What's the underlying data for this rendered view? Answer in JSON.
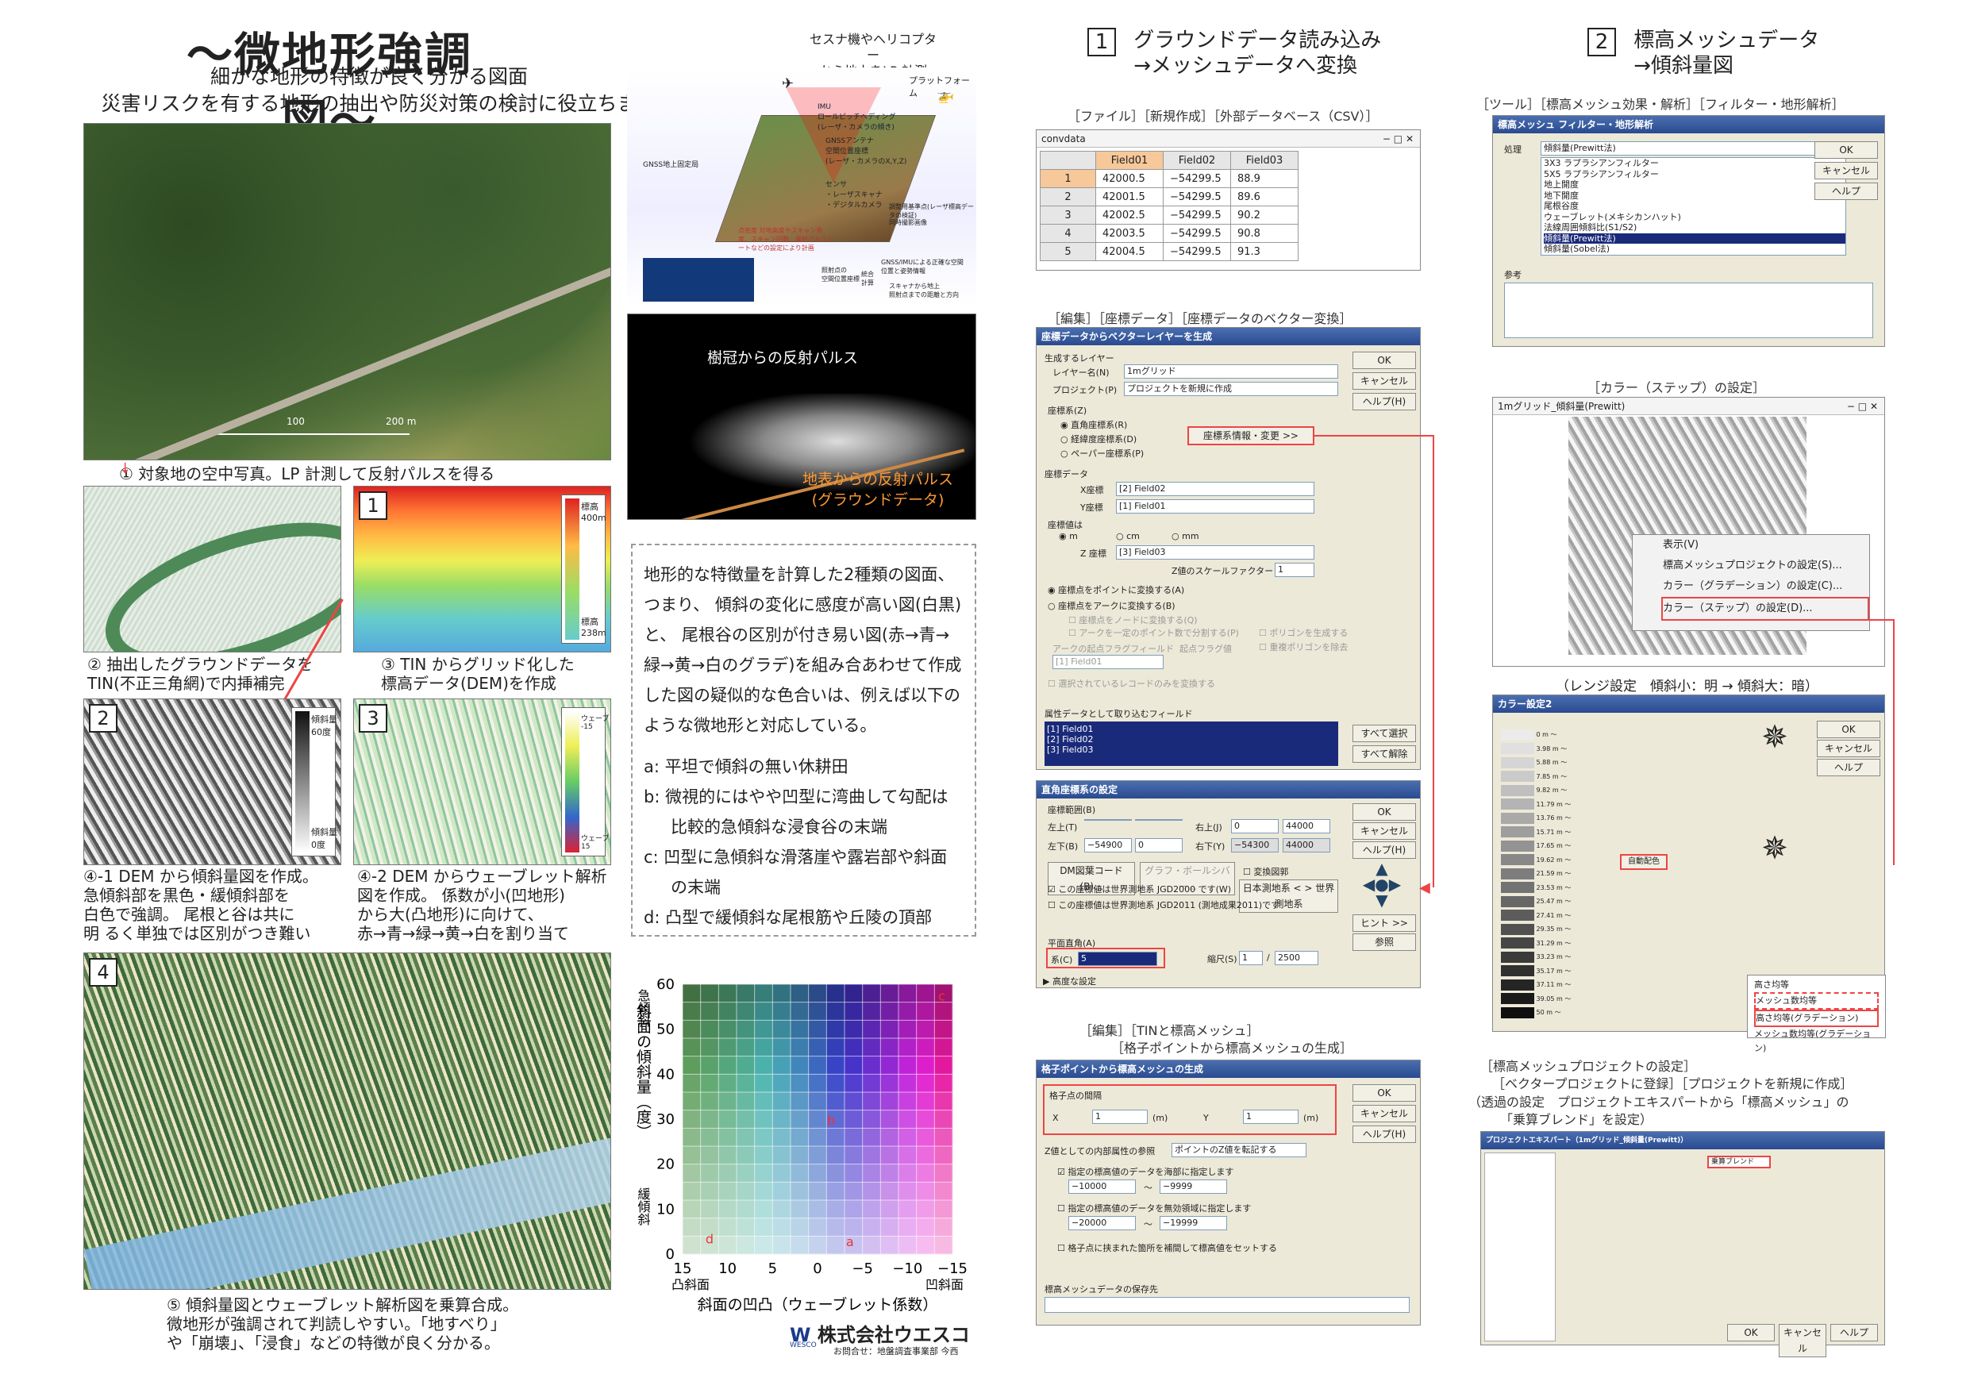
{
  "header": {
    "title": "〜微地形強調図〜",
    "subtitle1": "細かな地形の特徴が良く分かる図面",
    "subtitle2": "災害リスクを有する地形の抽出や防災対策の検討に役立ちます"
  },
  "captions": {
    "c1": "①  対象地の空中写真。LP 計測して反射パルスを得る",
    "c2a": "②  抽出したグラウンドデータを",
    "c2b": "TIN(不正三角網)で内挿補完",
    "c3a": "③  TIN からグリッド化した",
    "c3b": "標高データ(DEM)を作成",
    "c41a": "④-1 DEM から傾斜量図を作成。",
    "c41b": "急傾斜部を黒色・緩傾斜部を",
    "c41c": "白色で強調。 尾根と谷は共に",
    "c41d": "明 るく単独では区別がつき難い",
    "c42a": "④-2 DEM からウェーブレット解析",
    "c42b": "図を作成。 係数が小(凹地形)",
    "c42c": "から大(凸地形)に向けて、",
    "c42d": "赤→青→緑→黄→白を割り当て",
    "c5a": "⑤  傾斜量図とウェーブレット解析図を乗算合成。",
    "c5b": "微地形が強調されて判読しやすい。「地すべり」",
    "c5c": "や「崩壊」、「浸食」などの特徴が良く分かる。"
  },
  "panels": {
    "n1": "1",
    "n2": "2",
    "n3": "3",
    "n4": "4",
    "scale1": "100",
    "scale2": "200 m",
    "dem_top": "標高\n400m",
    "dem_bot": "標高\n238m",
    "slope_top": "傾斜量\n60度",
    "slope_bot": "傾斜量\n0度",
    "wav_top": "ウェーブレット係数\n-15",
    "wav_bot": "ウェーブレット係数\n15"
  },
  "lp": {
    "head1": "セスナ機やヘリコプター",
    "head2": "から地上をLP 計測",
    "platform": "プラットフォーム",
    "imu": "IMU\nロールピッチヘディング\n(レーザ・カメラの傾き)",
    "gnss_ant": "GNSSアンテナ\n空間位置座標\n(レーザ・カメラのX,Y,Z)",
    "sensor": "センサ\n・レーザスキャナ\n・デジタルカメラ",
    "ground_station": "GNSS地上固定局",
    "legend1": "調整用基準点(レーザ標高データの検証)",
    "legend2": "同時撮影画像",
    "irradiation": "照射点の\n空間位置座標",
    "integrated": "統合\n計算",
    "gnss_imu": "GNSS/IMUによる正確な空間位置と姿勢情報",
    "scanner": "スキャナから地上\n照射点までの距離と方向",
    "rr": "点密度\n対地高度やスキャン角度、スキャン回数、発射パルスレートなどの設定により計画"
  },
  "pulse": {
    "canopy": "樹冠からの反射パルス",
    "ground1": "地表からの反射パルス",
    "ground2": "(グラウンドデータ)"
  },
  "explain": {
    "p": "地形的な特徴量を計算した2種類の図面、つまり、 傾斜の変化に感度が高い図(白黒)と、 尾根谷の区別が付き易い図(赤→青→緑→黄→白のグラデ)を組み合あわせて作成した図の疑似的な色合いは、例えば以下のような微地形と対応している。",
    "a": "a: 平坦で傾斜の無い休耕田",
    "b": "b: 微視的にはやや凹型に湾曲して勾配は比較的急傾斜な浸食谷の末端",
    "c": "c: 凹型に急傾斜な滑落崖や露岩部や斜面の末端",
    "d": "d: 凸型で緩傾斜な尾根筋や丘陵の頂部"
  },
  "chart_data": {
    "type": "heatmap",
    "ylabel": "斜面の傾斜量（度）",
    "xlabel": "斜面の凹凸（ウェーブレット係数）",
    "y_top": "急傾斜",
    "y_bottom": "緩傾斜",
    "x_left": "凸斜面",
    "x_right": "凹斜面",
    "yticks": [
      60,
      50,
      40,
      30,
      20,
      10,
      0
    ],
    "xticks": [
      "15",
      "10",
      "5",
      "0",
      "−5",
      "−10",
      "−15"
    ],
    "ylim": [
      0,
      60
    ],
    "xlim": [
      15,
      -15
    ],
    "annotations": [
      "a",
      "b",
      "c",
      "d"
    ]
  },
  "company": {
    "name": "株式会社ウエスコ",
    "contact": "お問合せ：地盤調査事業部 今西",
    "mark": "WESCO"
  },
  "step1": {
    "num": "1",
    "line1": "グラウンドデータ読み込み",
    "line2": "→メッシュデータへ変換",
    "menu": "［ファイル］［新規作成］［外部データベース（CSV）］",
    "win_title": "convdata",
    "cols": [
      "Field01",
      "Field02",
      "Field03"
    ],
    "rows": [
      [
        "1",
        "42000.5",
        "−54299.5",
        "88.9"
      ],
      [
        "2",
        "42001.5",
        "−54299.5",
        "89.6"
      ],
      [
        "3",
        "42002.5",
        "−54299.5",
        "90.2"
      ],
      [
        "4",
        "42003.5",
        "−54299.5",
        "90.8"
      ],
      [
        "5",
        "42004.5",
        "−54299.5",
        "91.3"
      ]
    ]
  },
  "vec": {
    "menu": "［編集］［座標データ］［座標データのベクター変換］",
    "title": "座標データからベクターレイヤーを生成",
    "gen_layer": "生成するレイヤー",
    "layer_name": "レイヤー名(N)",
    "layer_val": "1mグリッド",
    "project": "プロジェクト(P)",
    "project_val": "プロジェクトを新規に作成",
    "coord": "座標系(Z)",
    "rect": "直角座標系(R)",
    "latlon": "経緯度座標系(D)",
    "paper": "ペーパー座標系(P)",
    "coordbtn": "座標系情報・変更 >>",
    "coord_data": "座標データ",
    "x": "X座標",
    "x_val": "[2] Field02",
    "y": "Y座標",
    "y_val": "[1] Field01",
    "unit": "座標値は",
    "m": "m",
    "cm": "cm",
    "mm": "mm",
    "z": "Z 座標",
    "z_val": "[3] Field03",
    "zscale": "Z値のスケールファクター",
    "zscale_val": "1",
    "as_point": "座標点をポイントに変換する(A)",
    "as_arc": "座標点をアークに変換する(B)",
    "as_node": "座標点をノードに変換する(Q)",
    "arc_split": "アークを一定のポイント数で分割する(P)",
    "poly": "ポリゴンを生成する",
    "poly2": "重複ポリゴンを除去",
    "arc_field": "アークの起点フラグフィールド",
    "start_flag": "起点フラグ値",
    "field_val": "[1] Field01",
    "selected": "選択されているレコードのみを変換する",
    "attr": "属性データとして取り込むフィールド",
    "fields": [
      "[1] Field01",
      "[2] Field02",
      "[3] Field03"
    ],
    "ok": "OK",
    "cancel": "キャンセル",
    "help": "ヘルプ(H)",
    "selall": "すべて選択",
    "clearall": "すべて解除"
  },
  "rect": {
    "title": "直角座標系の設定",
    "range": "座標範囲(B)",
    "left_top": "左上(T)",
    "right_top": "右上(J)",
    "left_bot": "左下(B)",
    "right_bot": "右下(Y)",
    "v1": "0",
    "v2": "44000",
    "v3": "−54900",
    "v4": "44000",
    "v5": "−54300",
    "dm": "DM図葉コード(B)...",
    "grid": "グラフ・ボールシバー...",
    "trans": "変換図郭",
    "jgd2000": "この座標値は世界測地系 JGD2000 です(W)",
    "convbtn": "日本測地系 < > 世界測地系",
    "jgd2011": "この座標値は世界測地系 JGD2011 (測地成果2011)です",
    "zone": "平面直角(A)",
    "kei": "系(C)",
    "kei_val": "5",
    "scale": "縮尺(S)",
    "scale1": "1",
    "scale2": "2500",
    "detail": "▶ 高度な設定",
    "ok": "OK",
    "cancel": "キャンセル",
    "help": "ヘルプ(H)",
    "hint": "ヒント >>",
    "ref": "参照"
  },
  "mesh": {
    "menu1": "［編集］［TINと標高メッシュ］",
    "menu2": "［格子ポイントから標高メッシュの生成］",
    "title": "格子ポイントから標高メッシュの生成",
    "interval": "格子点の間隔",
    "x": "X",
    "x_val": "1",
    "y": "Y",
    "y_val": "1",
    "unit": "(m)",
    "zattr": "Z値としての内部属性の参照",
    "zattr_val": "ポイントのZ値を転記する",
    "sea": "指定の標高値のデータを海部に指定します",
    "sea1": "−10000",
    "sea2": "−9999",
    "inv": "指定の標高値のデータを無効領域に指定します",
    "inv1": "−20000",
    "inv2": "−19999",
    "interp": "格子点に挟まれた箇所を補間して標高値をセットする",
    "save": "標高メッシュデータの保存先",
    "ok": "OK",
    "cancel": "キャンセル",
    "help": "ヘルプ(H)",
    "tilde": "〜"
  },
  "step2": {
    "num": "2",
    "line1": "標高メッシュデータ",
    "line2": "→傾斜量図",
    "menu": "［ツール］［標高メッシュ効果・解析］［フィルター・地形解析］",
    "win_title": "標高メッシュ フィルター・地形解析",
    "proc": "処理",
    "proc_val": "傾斜量(Prewitt法)",
    "ref": "参考",
    "options": [
      "3X3 ラプラシアンフィルター",
      "5X5 ラプラシアンフィルター",
      "地上開度",
      "地下開度",
      "尾根谷度",
      "ウェーブレット(メキシカンハット)",
      "法線周囲傾斜比(S1/S2)",
      "傾斜量(Prewitt法)",
      "傾斜量(Sobel法)"
    ],
    "ok": "OK",
    "cancel": "キャンセル",
    "help": "ヘルプ"
  },
  "color": {
    "menu": "［カラー（ステップ）の設定］",
    "win_title": "1mグリッド_傾斜量(Prewitt)",
    "ctx": [
      "表示(V)",
      "標高メッシュプロジェクトの設定(S)...",
      "カラー（グラデーション）の設定(C)...",
      "カラー（ステップ）の設定(D)..."
    ],
    "range_note": "（レンジ設定　傾斜小：明 → 傾斜大：暗）",
    "dlg_title": "カラー設定2",
    "steps": [
      "0 m 〜",
      "3.98 m 〜",
      "5.88 m 〜",
      "7.85 m 〜",
      "9.82 m 〜",
      "11.79 m 〜",
      "13.76 m 〜",
      "15.71 m 〜",
      "17.65 m 〜",
      "19.62 m 〜",
      "21.59 m 〜",
      "23.53 m 〜",
      "25.47 m 〜",
      "27.41 m 〜",
      "29.35 m 〜",
      "31.29 m 〜",
      "33.23 m 〜",
      "35.17 m 〜",
      "37.11 m 〜",
      "39.05 m 〜",
      "50 m 〜"
    ],
    "auto": "自動配色",
    "popup": [
      "高さ均等",
      "メッシュ数均等",
      "高さ均等(グラデーション)",
      "メッシュ数均等(グラデーション)"
    ],
    "ok": "OK",
    "cancel": "キャンセル",
    "help": "ヘルプ"
  },
  "proj": {
    "menu1": "［標高メッシュプロジェクトの設定］",
    "menu2": "［ベクタープロジェクトに登録］［プロジェクトを新規に作成］",
    "menu3": "（透過の設定　プロジェクトエキスパートから「標高メッシュ」の",
    "menu4": "「乗算ブレンド」を設定）",
    "win_title": "プロジェクトエキスパート（1mグリッド_傾斜量(Prewitt)）",
    "blend": "乗算ブレンド",
    "ok": "OK",
    "cancel": "キャンセル",
    "help": "ヘルプ"
  },
  "colors": {
    "accent_red": "#e44444",
    "title_blue": "#2a4a90"
  }
}
